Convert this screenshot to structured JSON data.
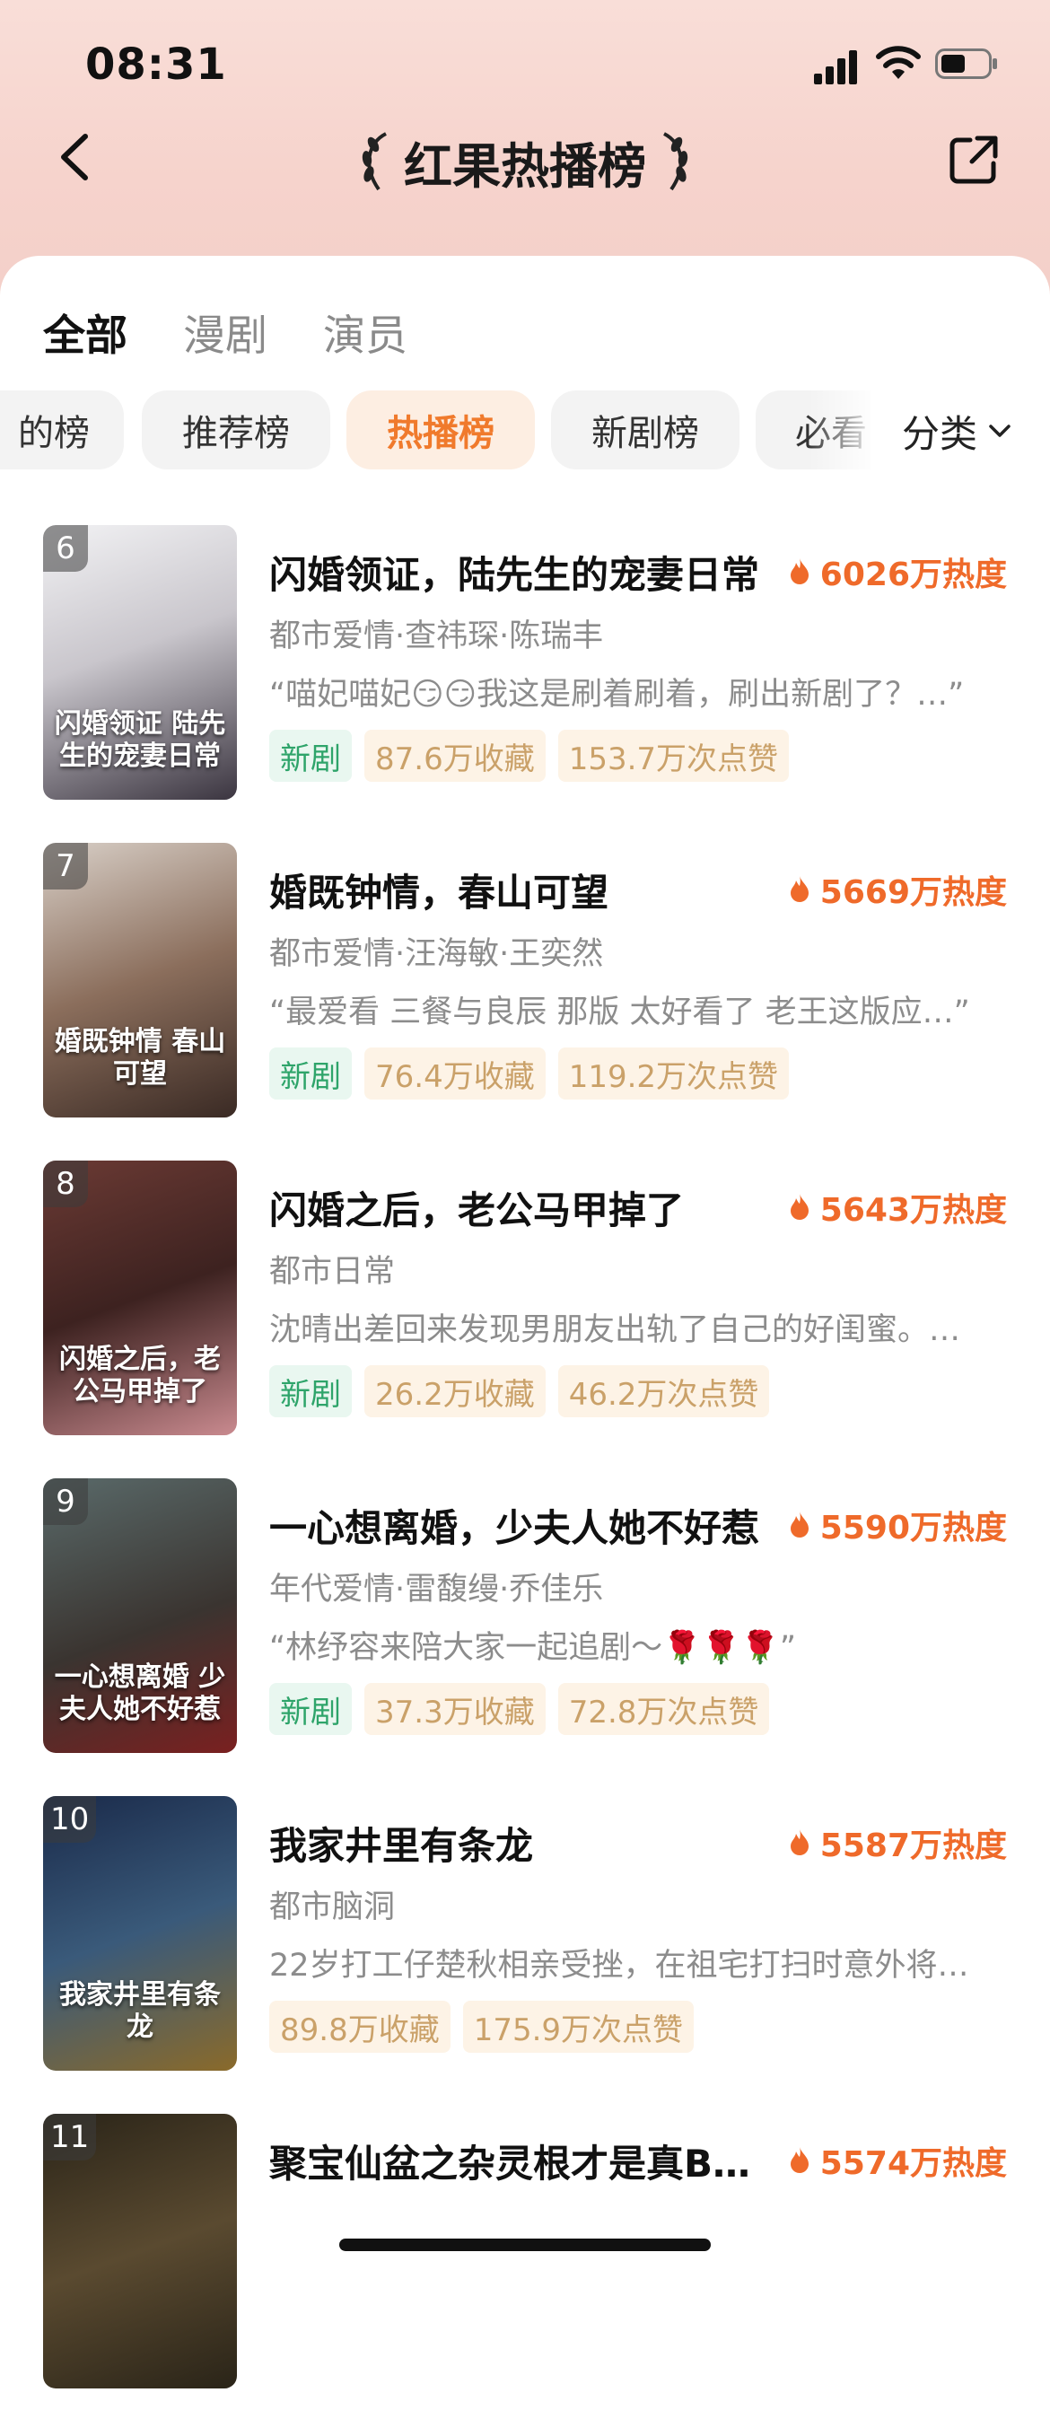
{
  "status_bar": {
    "time": "08:31"
  },
  "nav": {
    "title": "红果热播榜"
  },
  "top_tabs": [
    {
      "label": "全部",
      "active": true
    },
    {
      "label": "漫剧",
      "active": false
    },
    {
      "label": "演员",
      "active": false
    }
  ],
  "chips": [
    {
      "label": "的榜",
      "active": false
    },
    {
      "label": "推荐榜",
      "active": false
    },
    {
      "label": "热播榜",
      "active": true
    },
    {
      "label": "新剧榜",
      "active": false
    },
    {
      "label": "必看",
      "active": false
    }
  ],
  "category_label": "分类",
  "items": [
    {
      "rank": "6",
      "title": "闪婚领证，陆先生的宠妻日常",
      "heat": "6026万热度",
      "meta": "都市爱情·查祎琛·陈瑞丰",
      "quote": "“喵妃喵妃😏😏我这是刷着刷着，刷出新剧了？…”",
      "new_tag": "新剧",
      "favorites": "87.6万收藏",
      "likes": "153.7万次点赞",
      "poster_text": "闪婚领证 陆先生的宠妻日常",
      "poster_bg": "linear-gradient(160deg,#f2f2f4 0%,#c9c6cc 45%,#3b3540 100%)"
    },
    {
      "rank": "7",
      "title": "婚既钟情，春山可望",
      "heat": "5669万热度",
      "meta": "都市爱情·汪海敏·王奕然",
      "quote": "“最爱看 三餐与良辰 那版 太好看了 老王这版应…”",
      "new_tag": "新剧",
      "favorites": "76.4万收藏",
      "likes": "119.2万次点赞",
      "poster_text": "婚既钟情 春山可望",
      "poster_bg": "linear-gradient(160deg,#d8cfc7 0%,#8b6e5c 50%,#3a2a24 100%)"
    },
    {
      "rank": "8",
      "title": "闪婚之后，老公马甲掉了",
      "heat": "5643万热度",
      "meta": "都市日常",
      "quote": "沈晴出差回来发现男朋友出轨了自己的好闺蜜。…",
      "new_tag": "新剧",
      "favorites": "26.2万收藏",
      "likes": "46.2万次点赞",
      "poster_text": "闪婚之后，老公马甲掉了",
      "poster_bg": "linear-gradient(160deg,#6b3a34 0%,#3d2220 50%,#c98a8f 100%)"
    },
    {
      "rank": "9",
      "title": "一心想离婚，少夫人她不好惹",
      "heat": "5590万热度",
      "meta": "年代爱情·雷馥缦·乔佳乐",
      "quote": "“林纾容来陪大家一起追剧～🌹🌹🌹”",
      "new_tag": "新剧",
      "favorites": "37.3万收藏",
      "likes": "72.8万次点赞",
      "poster_text": "一心想离婚 少夫人她不好惹",
      "poster_bg": "linear-gradient(160deg,#5a6a6a 0%,#3a3430 55%,#7a2020 100%)"
    },
    {
      "rank": "10",
      "title": "我家井里有条龙",
      "heat": "5587万热度",
      "meta": "都市脑洞",
      "quote": "22岁打工仔楚秋相亲受挫，在祖宅打扫时意外将…",
      "new_tag": "",
      "favorites": "89.8万收藏",
      "likes": "175.9万次点赞",
      "poster_text": "我家井里有条龙",
      "poster_bg": "linear-gradient(160deg,#1a2a4a 0%,#3a5a7a 50%,#8a6a2a 100%)"
    },
    {
      "rank": "11",
      "title": "聚宝仙盆之杂灵根才是真BO…",
      "heat": "5574万热度",
      "meta": "",
      "quote": "",
      "new_tag": "",
      "favorites": "",
      "likes": "",
      "poster_text": "",
      "poster_bg": "linear-gradient(160deg,#2a2418 0%,#5a4a30 50%,#2a2418 100%)"
    }
  ]
}
